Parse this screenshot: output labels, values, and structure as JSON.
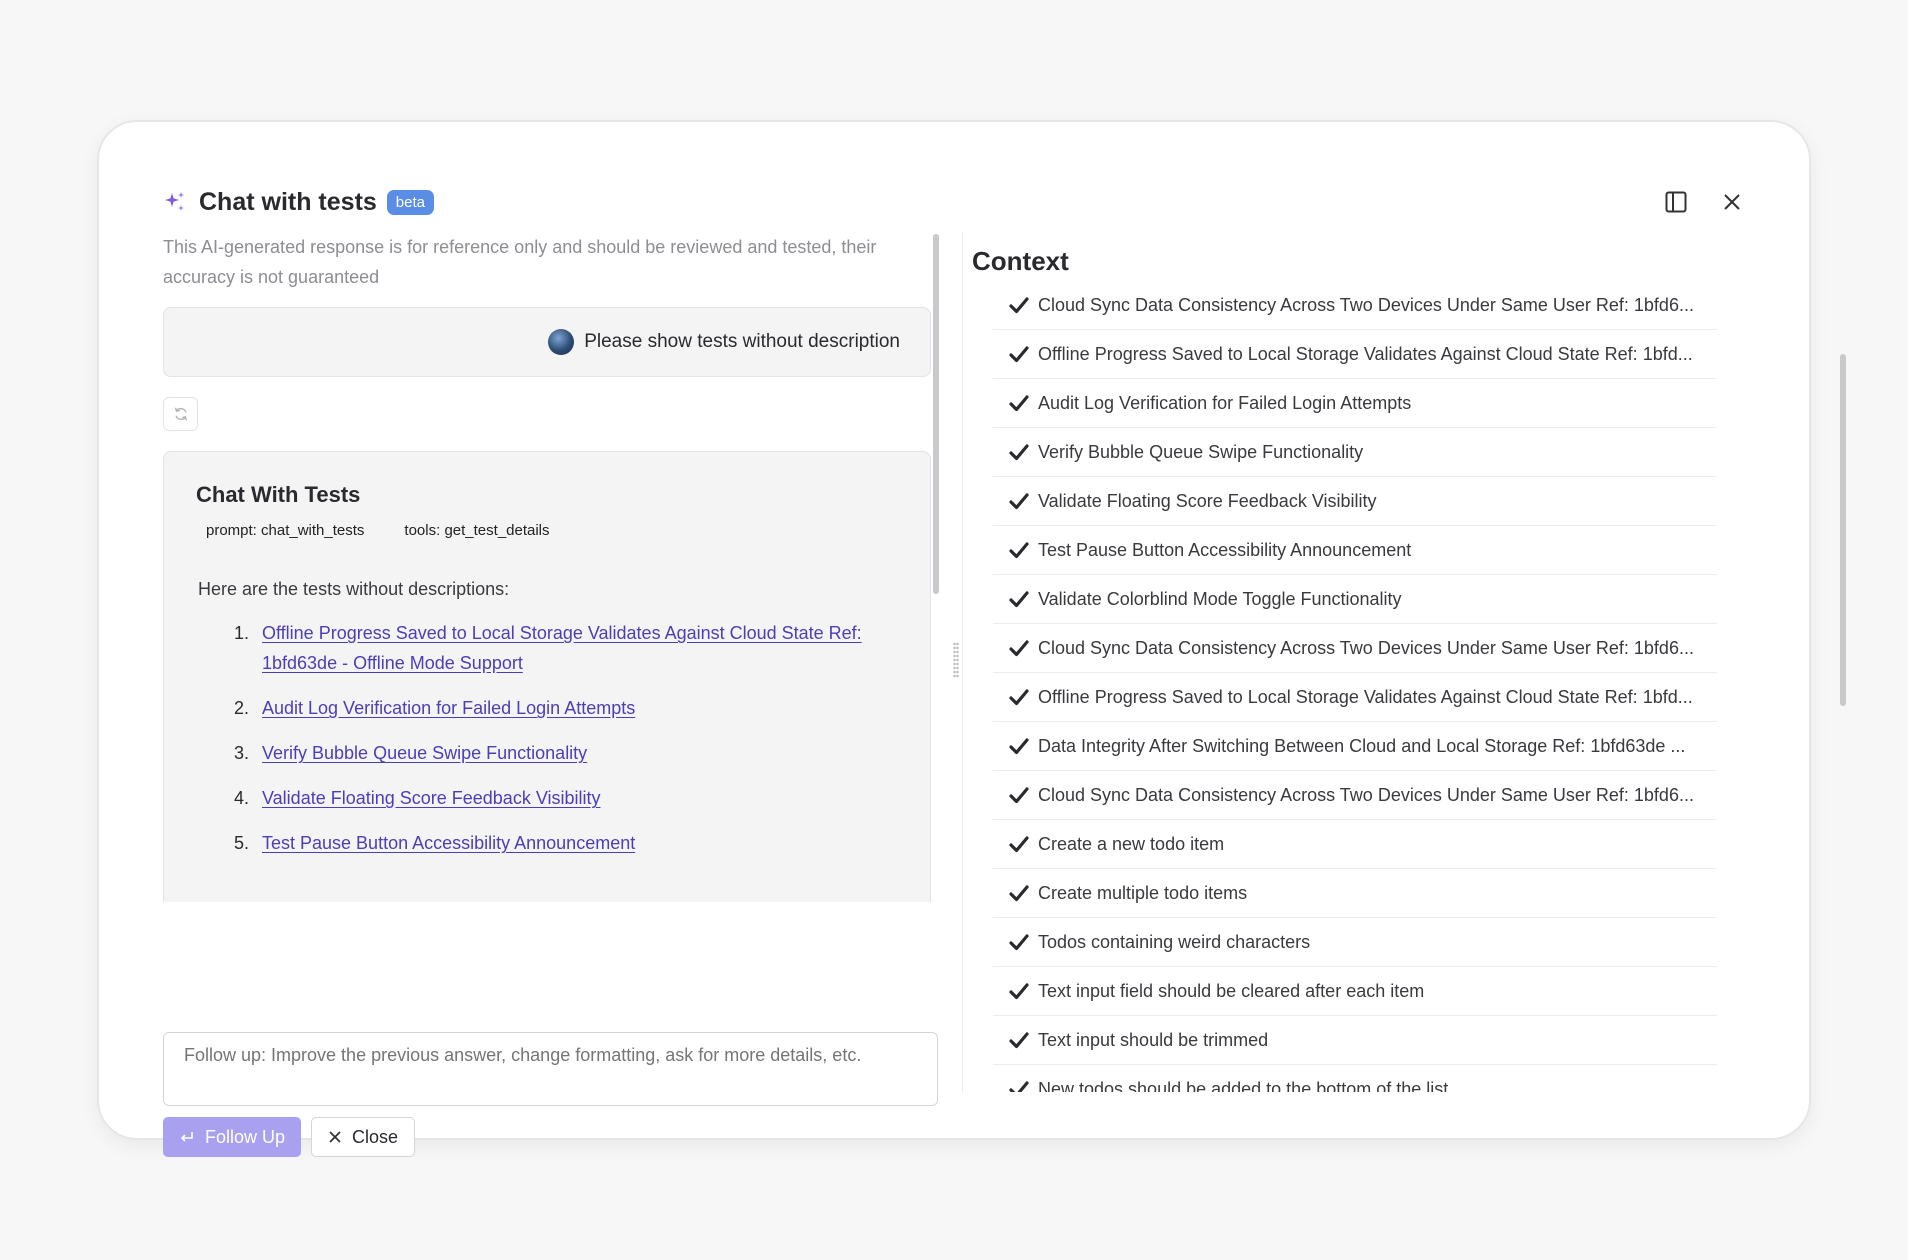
{
  "header": {
    "title": "Chat with tests",
    "badge": "beta",
    "icons": [
      "sparkle-icon",
      "sidebar-toggle-icon",
      "close-icon"
    ]
  },
  "left": {
    "disclaimer": "This AI-generated response is for reference only and should be reviewed and tested, their accuracy is not guaranteed",
    "user_message": "Please show tests without description",
    "answer": {
      "title": "Chat With Tests",
      "prompt": "prompt: chat_with_tests",
      "tools": "tools: get_test_details",
      "intro": "Here are the tests without descriptions:",
      "items": [
        {
          "num": "1.",
          "label": "Offline Progress Saved to Local Storage Validates Against Cloud State Ref: 1bfd63de - Offline Mode Support"
        },
        {
          "num": "2.",
          "label": "Audit Log Verification for Failed Login Attempts"
        },
        {
          "num": "3.",
          "label": "Verify Bubble Queue Swipe Functionality"
        },
        {
          "num": "4.",
          "label": "Validate Floating Score Feedback Visibility"
        },
        {
          "num": "5.",
          "label": "Test Pause Button Accessibility Announcement"
        }
      ]
    },
    "followup_placeholder": "Follow up: Improve the previous answer, change formatting, ask for more details, etc.",
    "follow_up_label": "Follow Up",
    "close_label": "Close"
  },
  "context": {
    "title": "Context",
    "items": [
      "Cloud Sync Data Consistency Across Two Devices Under Same User Ref: 1bfd6...",
      "Offline Progress Saved to Local Storage Validates Against Cloud State Ref: 1bfd...",
      "Audit Log Verification for Failed Login Attempts",
      "Verify Bubble Queue Swipe Functionality",
      "Validate Floating Score Feedback Visibility",
      "Test Pause Button Accessibility Announcement",
      "Validate Colorblind Mode Toggle Functionality",
      "Cloud Sync Data Consistency Across Two Devices Under Same User Ref: 1bfd6...",
      "Offline Progress Saved to Local Storage Validates Against Cloud State Ref: 1bfd...",
      "Data Integrity After Switching Between Cloud and Local Storage Ref: 1bfd63de ...",
      "Cloud Sync Data Consistency Across Two Devices Under Same User Ref: 1bfd6...",
      "Create a new todo item",
      "Create multiple todo items",
      "Todos containing weird characters",
      "Text input field should be cleared after each item",
      "Text input should be trimmed",
      "New todos should be added to the bottom of the list"
    ]
  },
  "colors": {
    "badge": "#5a8ee6",
    "link": "#4b3fb5",
    "follow_button": "#a9a0f0",
    "sparkle": "#7b5cd6"
  }
}
